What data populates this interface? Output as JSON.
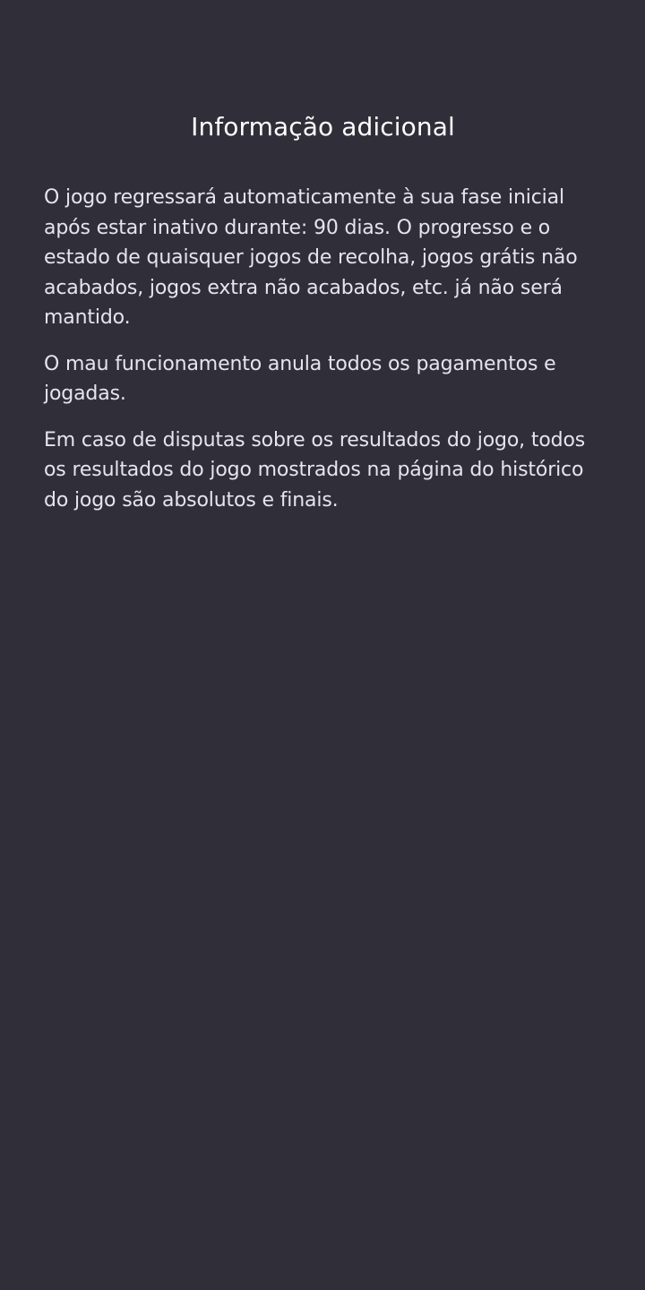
{
  "page": {
    "title": "Informação adicional",
    "paragraphs": [
      "O jogo regressará automaticamente à sua fase inicial após estar inativo durante: 90 dias. O progresso e o estado de quaisquer jogos de recolha, jogos grátis não acabados, jogos extra não acabados, etc. já não será mantido.",
      "O mau funcionamento anula todos os pagamentos e jogadas.",
      "Em caso de disputas sobre os resultados do jogo, todos os resultados do jogo mostrados na página do histórico do jogo são absolutos e finais."
    ]
  },
  "colors": {
    "background": "#302e38",
    "title_text": "#ffffff",
    "body_text": "#e6e4ec"
  }
}
